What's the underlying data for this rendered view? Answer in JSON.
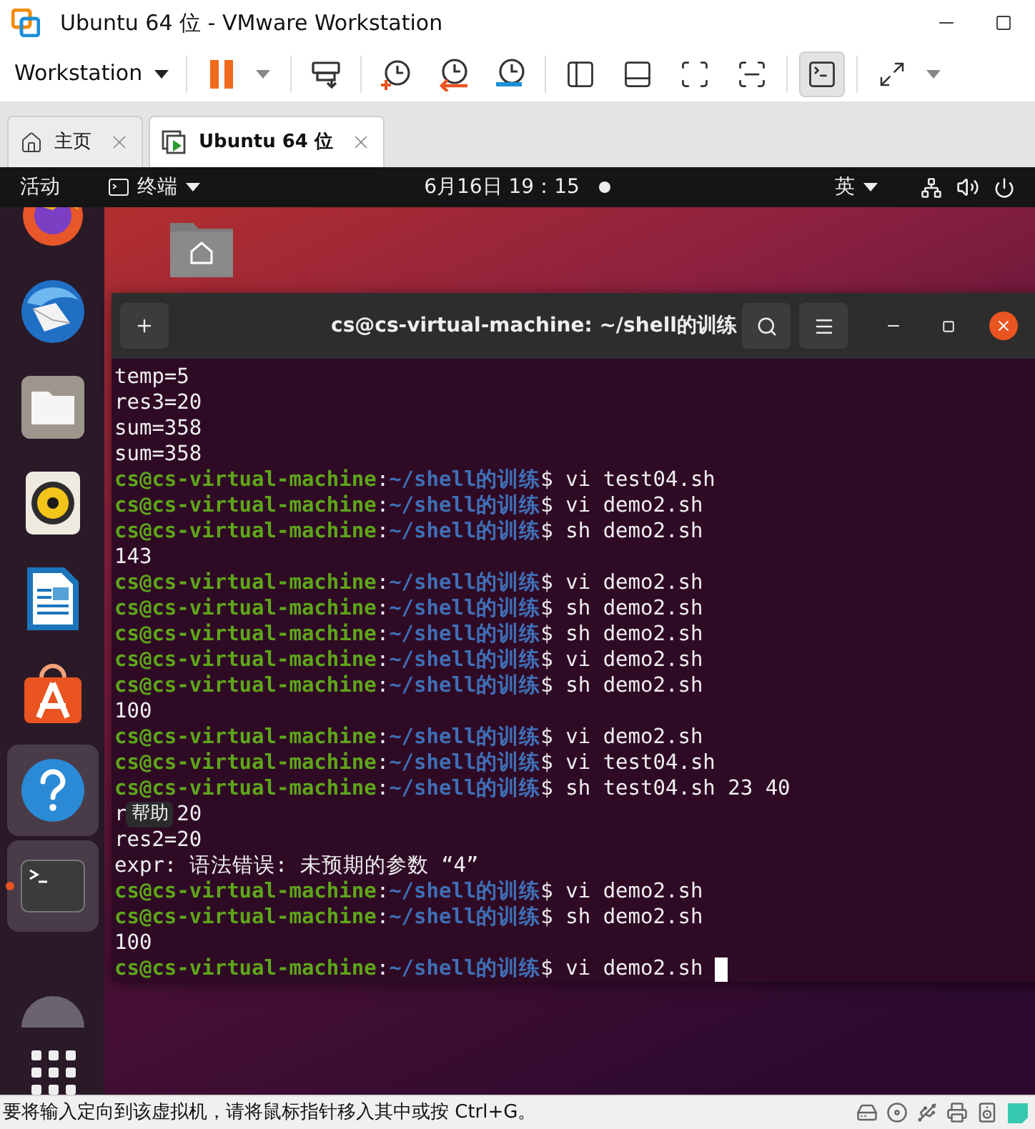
{
  "window": {
    "title": "Ubuntu 64 位 - VMware Workstation"
  },
  "toolbar": {
    "menu_label": "Workstation",
    "console_view_selected": true
  },
  "tabs": [
    {
      "label": "主页",
      "selected": false
    },
    {
      "label": "Ubuntu 64 位",
      "selected": true
    }
  ],
  "top_bar": {
    "activities": "活动",
    "app_menu": "终端",
    "clock": "6月16日 19：15",
    "input_method": "英"
  },
  "dock": [
    {
      "kind": "browser",
      "highlighted": false,
      "running": false
    },
    {
      "kind": "mail",
      "highlighted": false,
      "running": false
    },
    {
      "kind": "files",
      "highlighted": false,
      "running": false
    },
    {
      "kind": "music",
      "highlighted": false,
      "running": false
    },
    {
      "kind": "writer",
      "highlighted": false,
      "running": false
    },
    {
      "kind": "store",
      "highlighted": false,
      "running": false
    },
    {
      "kind": "help",
      "highlighted": true,
      "running": false
    },
    {
      "kind": "terminal",
      "highlighted": true,
      "running": true
    },
    {
      "kind": "disc",
      "highlighted": false,
      "running": false
    }
  ],
  "tooltip": "帮助",
  "terminal": {
    "title": "cs@cs-virtual-machine: ~/shell的训练",
    "lines": [
      {
        "kind": "output",
        "text": "temp=5"
      },
      {
        "kind": "output",
        "text": "res3=20"
      },
      {
        "kind": "output",
        "text": "sum=358"
      },
      {
        "kind": "output",
        "text": "sum=358"
      },
      {
        "kind": "prompt",
        "user": "cs@cs-virtual-machine",
        "colon": ":",
        "path": "~/shell的训练",
        "dollar": "$",
        "command": "vi test04.sh"
      },
      {
        "kind": "prompt",
        "user": "cs@cs-virtual-machine",
        "colon": ":",
        "path": "~/shell的训练",
        "dollar": "$",
        "command": "vi demo2.sh"
      },
      {
        "kind": "prompt",
        "user": "cs@cs-virtual-machine",
        "colon": ":",
        "path": "~/shell的训练",
        "dollar": "$",
        "command": "sh demo2.sh"
      },
      {
        "kind": "output",
        "text": "143"
      },
      {
        "kind": "prompt",
        "user": "cs@cs-virtual-machine",
        "colon": ":",
        "path": "~/shell的训练",
        "dollar": "$",
        "command": "vi demo2.sh"
      },
      {
        "kind": "prompt",
        "user": "cs@cs-virtual-machine",
        "colon": ":",
        "path": "~/shell的训练",
        "dollar": "$",
        "command": "sh demo2.sh"
      },
      {
        "kind": "prompt",
        "user": "cs@cs-virtual-machine",
        "colon": ":",
        "path": "~/shell的训练",
        "dollar": "$",
        "command": "sh demo2.sh"
      },
      {
        "kind": "prompt",
        "user": "cs@cs-virtual-machine",
        "colon": ":",
        "path": "~/shell的训练",
        "dollar": "$",
        "command": "vi demo2.sh"
      },
      {
        "kind": "prompt",
        "user": "cs@cs-virtual-machine",
        "colon": ":",
        "path": "~/shell的训练",
        "dollar": "$",
        "command": "sh demo2.sh"
      },
      {
        "kind": "output",
        "text": "100"
      },
      {
        "kind": "prompt",
        "user": "cs@cs-virtual-machine",
        "colon": ":",
        "path": "~/shell的训练",
        "dollar": "$",
        "command": "vi demo2.sh"
      },
      {
        "kind": "prompt",
        "user": "cs@cs-virtual-machine",
        "colon": ":",
        "path": "~/shell的训练",
        "dollar": "$",
        "command": "vi test04.sh"
      },
      {
        "kind": "prompt",
        "user": "cs@cs-virtual-machine",
        "colon": ":",
        "path": "~/shell的训练",
        "dollar": "$",
        "command": "sh test04.sh 23 40"
      },
      {
        "kind": "covered",
        "text": "r",
        "text_2": "20"
      },
      {
        "kind": "output",
        "text": "res2=20"
      },
      {
        "kind": "output",
        "text": "expr: 语法错误: 未预期的参数 “4”"
      },
      {
        "kind": "prompt",
        "user": "cs@cs-virtual-machine",
        "colon": ":",
        "path": "~/shell的训练",
        "dollar": "$",
        "command": "vi demo2.sh"
      },
      {
        "kind": "prompt",
        "user": "cs@cs-virtual-machine",
        "colon": ":",
        "path": "~/shell的训练",
        "dollar": "$",
        "command": "sh demo2.sh"
      },
      {
        "kind": "output",
        "text": "100"
      },
      {
        "kind": "prompt",
        "user": "cs@cs-virtual-machine",
        "colon": ":",
        "path": "~/shell的训练",
        "dollar": "$",
        "command": "vi demo2.sh",
        "cursor": true
      }
    ]
  },
  "status_bar": {
    "message": "要将输入定向到该虚拟机，请将鼠标指针移入其中或按 Ctrl+G。"
  }
}
